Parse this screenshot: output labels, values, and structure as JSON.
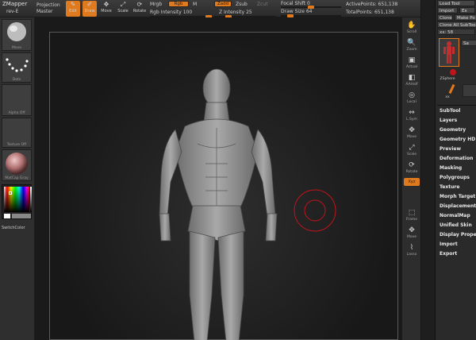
{
  "toolbar": {
    "app_title": "ZMapper",
    "app_sub": "rev-E",
    "projection": "Projection",
    "master": "Master",
    "tools": [
      {
        "label": "Edit",
        "icon": "edit-icon",
        "active": true
      },
      {
        "label": "Draw",
        "icon": "draw-icon",
        "active": true
      },
      {
        "label": "Move",
        "icon": "move-icon",
        "active": false
      },
      {
        "label": "Scale",
        "icon": "scale-icon",
        "active": false
      },
      {
        "label": "Rotate",
        "icon": "rotate-icon",
        "active": false
      }
    ],
    "mrgb": "Mrgb",
    "rgb": "Rgb",
    "m": "M",
    "rgb_intensity_label": "Rgb Intensity",
    "rgb_intensity_value": "100",
    "zadd": "Zadd",
    "zsub": "Zsub",
    "zcut": "Zcut",
    "z_intensity_label": "Z Intensity",
    "z_intensity_value": "25",
    "focal_shift_label": "Focal Shift",
    "focal_shift_value": "0",
    "draw_size_label": "Draw Size",
    "draw_size_value": "64",
    "active_points": "ActivePoints: 651,138",
    "total_points": "TotalPoints: 651,138"
  },
  "left_shelf": {
    "tiles": [
      {
        "label": "Move"
      },
      {
        "label": "Dots"
      },
      {
        "label": "Alpha Off"
      },
      {
        "label": "Texture Off"
      },
      {
        "label": "MatCap Gray"
      }
    ],
    "switch_color": "SwitchColor"
  },
  "right_tools": [
    {
      "label": "Scroll",
      "icon": "scroll-icon"
    },
    {
      "label": "Zoom",
      "icon": "zoom-icon"
    },
    {
      "label": "Actual",
      "icon": "actual-icon"
    },
    {
      "label": "AAHalf",
      "icon": "aahalf-icon"
    },
    {
      "label": "Local",
      "icon": "local-icon"
    },
    {
      "label": "L.Sym",
      "icon": "lsym-icon"
    },
    {
      "label": "Move",
      "icon": "move-icon"
    },
    {
      "label": "Scale",
      "icon": "scale-icon"
    },
    {
      "label": "Rotate",
      "icon": "rotate-icon"
    },
    {
      "label": "Xyz",
      "icon": "xyz-icon"
    },
    {
      "label": "Frame",
      "icon": "frame-icon"
    },
    {
      "label": "Move",
      "icon": "move-icon"
    },
    {
      "label": "Lasso",
      "icon": "lasso-icon"
    }
  ],
  "tool_palette": {
    "buttons": [
      "Load Tool",
      "Import",
      "Clone",
      "Make Po",
      "Clone All SubToo"
    ],
    "sub_small": "Ex",
    "sub_small2": "Sa",
    "scale_value": "xx: 58",
    "thumb1_label": "ZSphere",
    "thumb2_label": "xx",
    "menu": [
      "SubTool",
      "Layers",
      "Geometry",
      "Geometry HD",
      "Preview",
      "Deformation",
      "Masking",
      "Polygroups",
      "Texture",
      "Morph Target",
      "Displacement",
      "NormalMap",
      "Unified Skin",
      "Display Properties",
      "Import",
      "Export"
    ]
  },
  "colors": {
    "accent": "#e07a1e",
    "brush_ring": "#c0141a"
  }
}
